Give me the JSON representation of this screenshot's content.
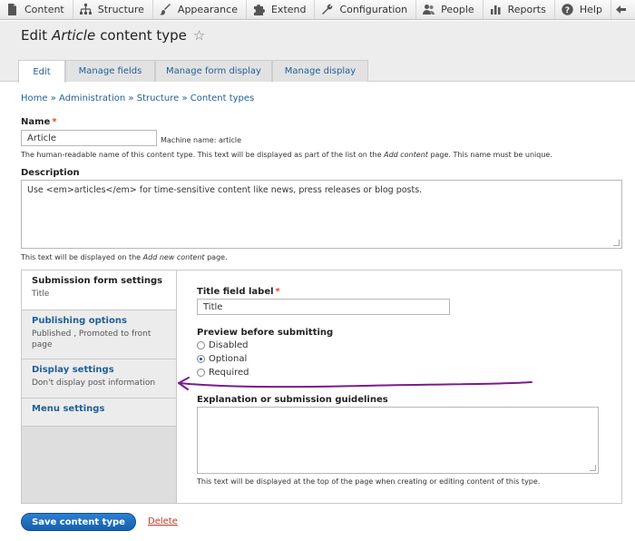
{
  "toolbar": {
    "items": [
      {
        "label": "Content",
        "icon": "file-icon"
      },
      {
        "label": "Structure",
        "icon": "structure-icon"
      },
      {
        "label": "Appearance",
        "icon": "paintbrush-icon"
      },
      {
        "label": "Extend",
        "icon": "puzzle-icon"
      },
      {
        "label": "Configuration",
        "icon": "wrench-icon"
      },
      {
        "label": "People",
        "icon": "people-icon"
      },
      {
        "label": "Reports",
        "icon": "chart-icon"
      },
      {
        "label": "Help",
        "icon": "question-icon"
      }
    ],
    "partial_icon": "back-arrow-icon"
  },
  "page": {
    "title_prefix": "Edit",
    "title_em": "Article",
    "title_suffix": "content type",
    "star": "☆"
  },
  "tabs": [
    "Edit",
    "Manage fields",
    "Manage form display",
    "Manage display"
  ],
  "breadcrumb": [
    "Home",
    "Administration",
    "Structure",
    "Content types"
  ],
  "breadcrumb_sep": "»",
  "form": {
    "name_label": "Name",
    "required_mark": "*",
    "name_value": "Article",
    "machine_name": "Machine name: article",
    "name_help_pre": "The human-readable name of this content type. This text will be displayed as part of the list on the",
    "name_help_em": "Add content",
    "name_help_post": "page. This name must be unique.",
    "description_label": "Description",
    "description_value": "Use <em>articles</em> for time-sensitive content like news, press releases or blog posts.",
    "description_help_pre": "This text will be displayed on the",
    "description_help_em": "Add new content",
    "description_help_post": "page."
  },
  "vertical_tabs": [
    {
      "title": "Submission form settings",
      "summary": "Title"
    },
    {
      "title": "Publishing options",
      "summary": "Published , Promoted to front page"
    },
    {
      "title": "Display settings",
      "summary": "Don't display post information"
    },
    {
      "title": "Menu settings",
      "summary": ""
    }
  ],
  "submission": {
    "title_label": "Title field label",
    "title_value": "Title",
    "preview_label": "Preview before submitting",
    "preview_options": [
      "Disabled",
      "Optional",
      "Required"
    ],
    "preview_selected": "Optional",
    "guidelines_label": "Explanation or submission guidelines",
    "guidelines_help": "This text will be displayed at the top of the page when creating or editing content of this type."
  },
  "actions": {
    "save": "Save content type",
    "delete": "Delete"
  },
  "colors": {
    "link": "#1f5f99",
    "button": "#1560ae",
    "delete": "#c0392b",
    "annotation": "#7a1c8c"
  }
}
